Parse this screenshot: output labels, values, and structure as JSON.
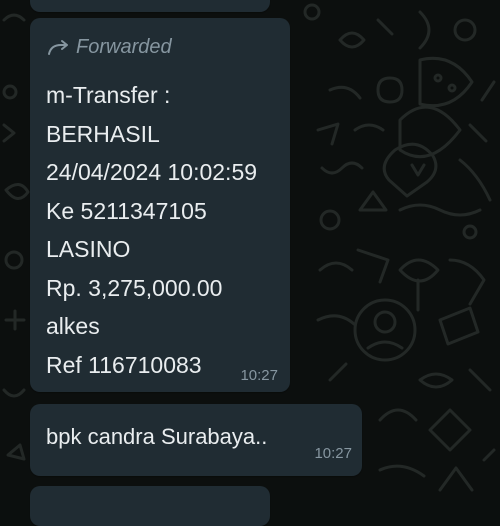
{
  "chat": {
    "background_color": "#0c0f0e",
    "bubble_color": "#202c33",
    "text_color": "#e9edef",
    "meta_color": "#8696a0"
  },
  "messages": [
    {
      "forwarded_label": "Forwarded",
      "forwarded_icon": "forward-arrow-icon",
      "lines": [
        "m-Transfer :",
        "BERHASIL",
        "24/04/2024 10:02:59",
        "Ke 5211347105",
        "LASINO",
        "Rp. 3,275,000.00",
        "alkes",
        "Ref 116710083"
      ],
      "time": "10:27"
    },
    {
      "text": "bpk candra Surabaya..",
      "time": "10:27"
    }
  ]
}
